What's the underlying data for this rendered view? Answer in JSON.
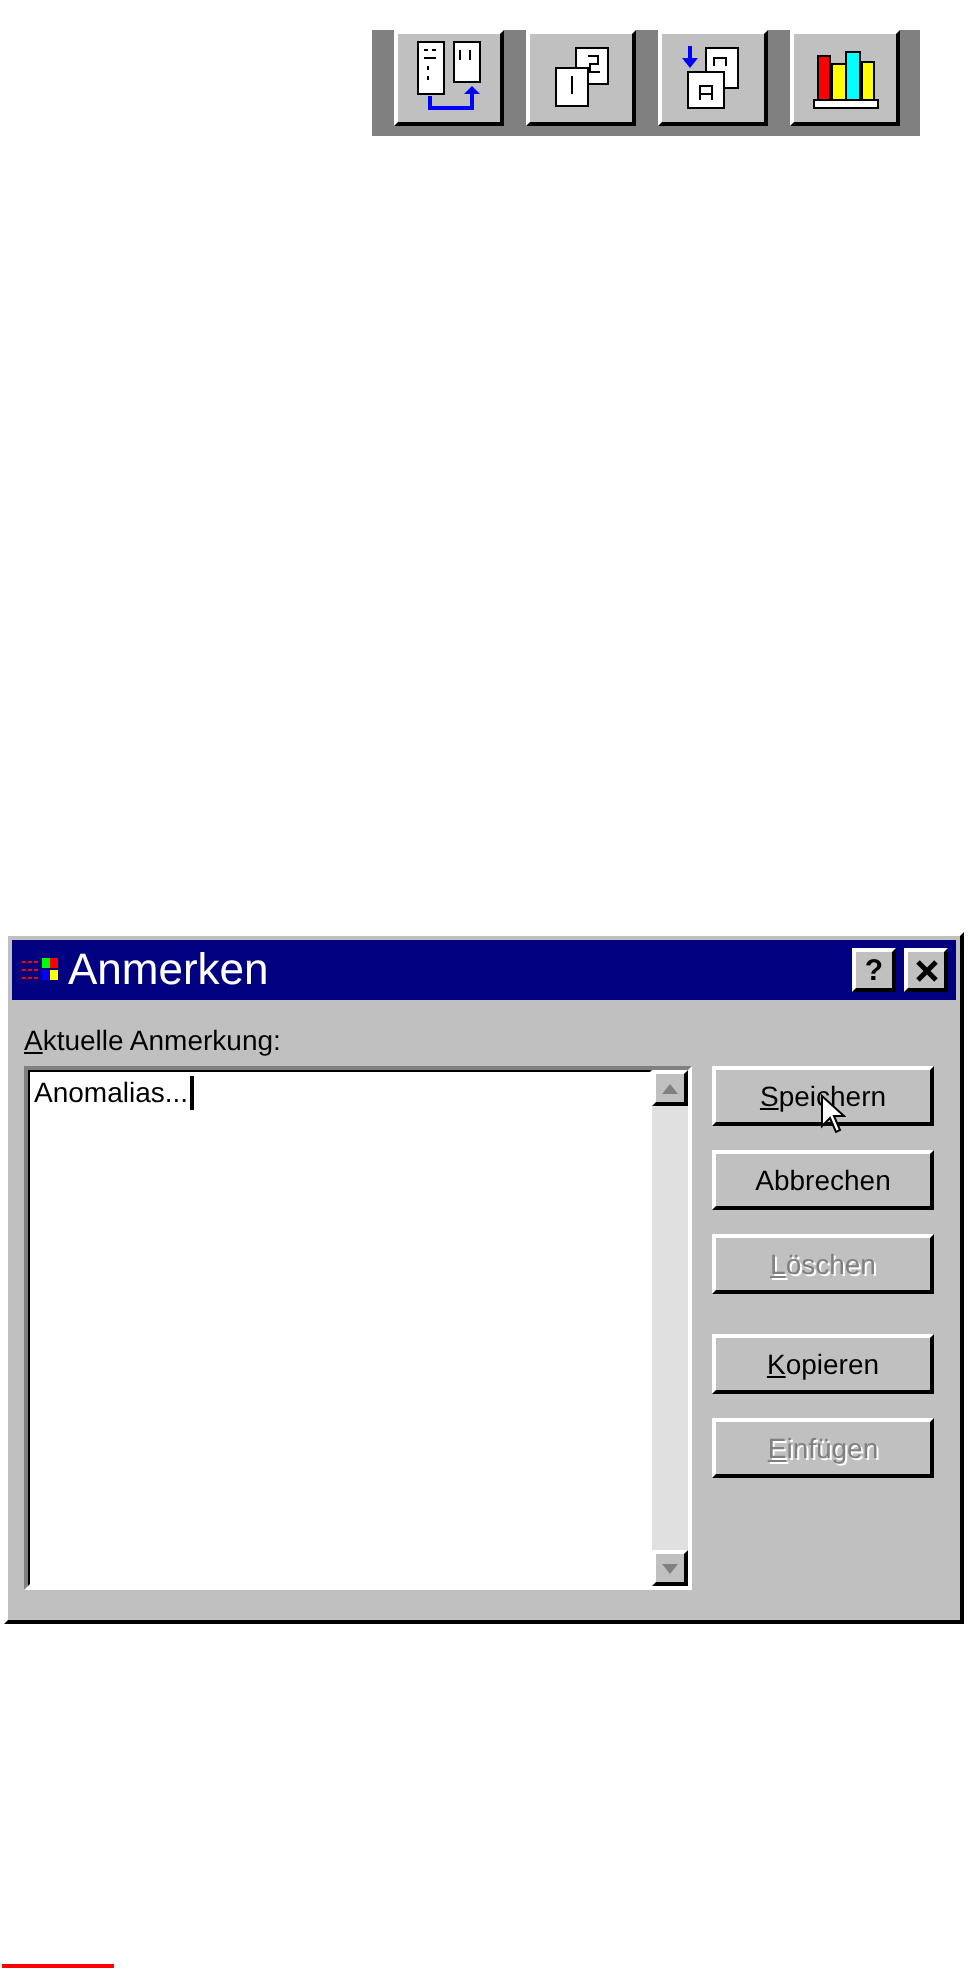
{
  "toolbar": {
    "buttons": [
      {
        "kind": "compare"
      },
      {
        "kind": "pages"
      },
      {
        "kind": "swap"
      },
      {
        "kind": "books"
      }
    ]
  },
  "dialog": {
    "title": "Anmerken",
    "title_buttons": [
      {
        "kind": "help",
        "label": "?"
      },
      {
        "kind": "close"
      }
    ],
    "field_label": "Aktuelle Anmerkung:",
    "field_label_initial_underlined": true,
    "note": {
      "value": "Anomalias..."
    },
    "button_groups": [
      [
        {
          "label": "Speichern",
          "initial_underlined": true,
          "disabled": false,
          "hovered": true
        },
        {
          "label": "Abbrechen",
          "initial_underlined": false,
          "disabled": false,
          "hovered": false
        },
        {
          "label": "Löschen",
          "initial_underlined": true,
          "disabled": true,
          "hovered": false
        }
      ],
      [
        {
          "label": "Kopieren",
          "initial_underlined": true,
          "disabled": false,
          "hovered": false
        },
        {
          "label": "Einfügen",
          "initial_underlined": true,
          "disabled": true,
          "hovered": false
        }
      ]
    ]
  }
}
